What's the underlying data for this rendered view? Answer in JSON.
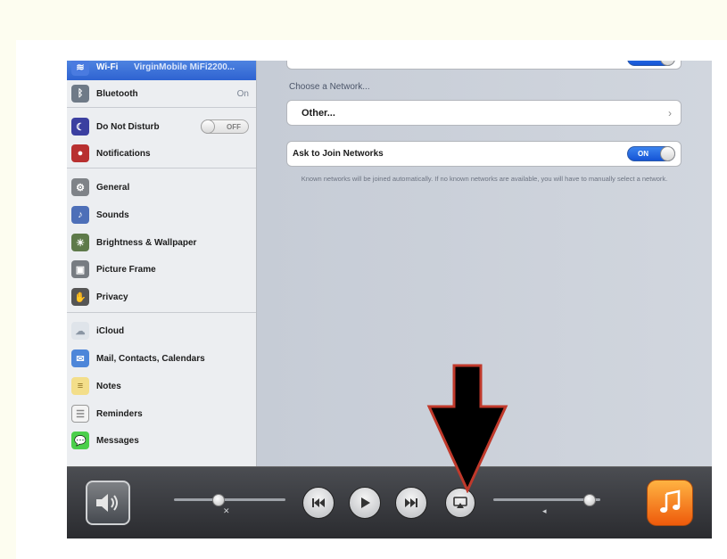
{
  "sidebar": {
    "items": [
      {
        "label": "Wi-Fi",
        "value": "VirginMobile MiFi2200...",
        "icon": "wifi-icon",
        "color": "#4a7be0",
        "selected": true
      },
      {
        "label": "Bluetooth",
        "value": "On",
        "icon": "bluetooth-icon",
        "color": "#6f7a87"
      },
      {
        "label": "Do Not Disturb",
        "value": "",
        "toggle": "OFF",
        "icon": "moon-icon",
        "color": "#3b3fa0"
      },
      {
        "label": "Notifications",
        "value": "",
        "icon": "notifications-icon",
        "color": "#b83030"
      },
      {
        "label": "General",
        "value": "",
        "icon": "gear-icon",
        "color": "#7f8388"
      },
      {
        "label": "Sounds",
        "value": "",
        "icon": "speaker-icon",
        "color": "#4d6fb8"
      },
      {
        "label": "Brightness & Wallpaper",
        "value": "",
        "icon": "sun-icon",
        "color": "#5e7a4a"
      },
      {
        "label": "Picture Frame",
        "value": "",
        "icon": "picture-frame-icon",
        "color": "#777c82"
      },
      {
        "label": "Privacy",
        "value": "",
        "icon": "hand-icon",
        "color": "#555"
      },
      {
        "label": "iCloud",
        "value": "",
        "icon": "cloud-icon",
        "color": "#dfe4ea"
      },
      {
        "label": "Mail, Contacts, Calendars",
        "value": "",
        "icon": "mail-icon",
        "color": "#4d86d9"
      },
      {
        "label": "Notes",
        "value": "",
        "icon": "notes-icon",
        "color": "#f3de8a"
      },
      {
        "label": "Reminders",
        "value": "",
        "icon": "reminders-icon",
        "color": "#f4f4f4"
      },
      {
        "label": "Messages",
        "value": "",
        "icon": "messages-icon",
        "color": "#4bcf4b"
      }
    ]
  },
  "main": {
    "choose_label": "Choose a Network...",
    "other_label": "Other...",
    "ask_label": "Ask to Join Networks",
    "ask_toggle": "ON",
    "footnote": "Known networks will be joined automatically. If no known networks are available, you will have to manually select a network.",
    "chevron": "›"
  },
  "controls": {
    "playback_position": 0.4,
    "volume_level": 0.9,
    "airplay_highlighted": true
  }
}
